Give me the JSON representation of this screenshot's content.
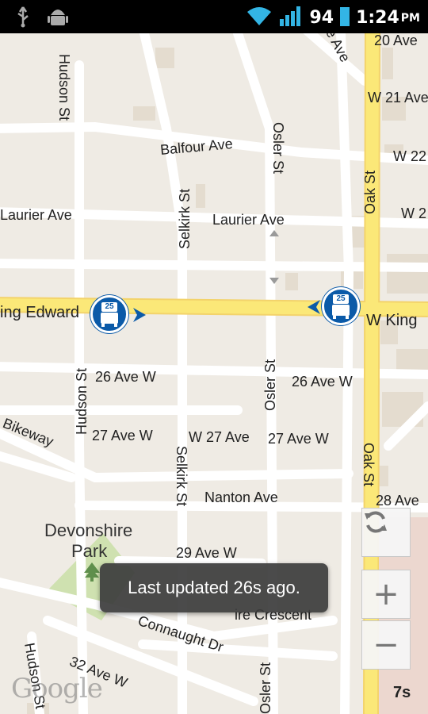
{
  "status_bar": {
    "battery_percent": "94",
    "time": "1:24",
    "ampm": "PM",
    "icons": [
      "usb-icon",
      "android-debug-icon",
      "wifi-icon",
      "signal-icon",
      "battery-icon"
    ]
  },
  "map": {
    "streets": {
      "hudson_top": "Hudson St",
      "hudson_mid": "Hudson St",
      "hudson_bottom": "Hudson St",
      "selkirk_top": "Selkirk St",
      "selkirk_bottom": "Selkirk St",
      "osler_top": "Osler St",
      "osler_mid": "Osler St",
      "osler_bottom": "Osler St",
      "oak_top": "Oak St",
      "oak_bottom": "Oak St",
      "balfour": "Balfour Ave",
      "laurier_left": "Laurier Ave",
      "laurier_mid": "Laurier Ave",
      "king_edward_left": "ing Edward",
      "king_edward_right": "W King",
      "ave26_left": "26 Ave W",
      "ave26_right": "26 Ave W",
      "ave27_left": "27 Ave W",
      "ave27_mid": "W 27 Ave",
      "ave27_right": "27 Ave W",
      "nanton": "Nanton Ave",
      "ave28": "28 Ave",
      "ave29": "29 Ave W",
      "ave32": "32 Ave W",
      "ave20": "20 Ave",
      "w21": "W 21 Ave",
      "w22": "W 22",
      "w2": "W 2",
      "e_ave": "e Ave",
      "bikeway": "Bikeway",
      "crescent": "ire Crescent",
      "connaught": "Connaught Dr"
    },
    "park": {
      "line1": "Devonshire",
      "line2": "Park"
    },
    "buses": [
      {
        "route": "25",
        "direction": "east"
      },
      {
        "route": "25",
        "direction": "west"
      }
    ]
  },
  "controls": {
    "refresh_icon": "refresh-icon",
    "zoom_in": "+",
    "zoom_out": "−"
  },
  "toast": "Last updated 26s ago.",
  "attribution": "Google",
  "timer": "7s",
  "colors": {
    "map_bg": "#efebe4",
    "major_road": "#fbe878",
    "bus_blue": "#0b5aa8"
  }
}
